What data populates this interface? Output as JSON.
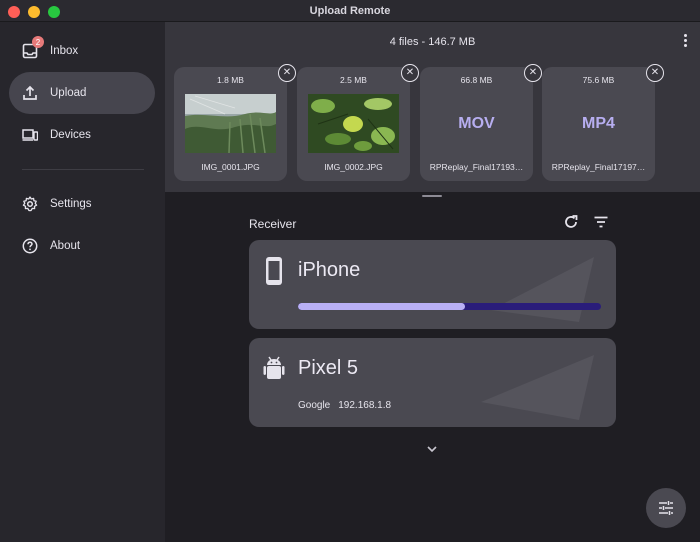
{
  "window": {
    "title": "Upload Remote"
  },
  "sidebar": {
    "items": [
      {
        "label": "Inbox",
        "icon": "inbox-icon",
        "badge": "2"
      },
      {
        "label": "Upload",
        "icon": "upload-icon",
        "active": true
      },
      {
        "label": "Devices",
        "icon": "devices-icon"
      },
      {
        "label": "Settings",
        "icon": "gear-icon"
      },
      {
        "label": "About",
        "icon": "help-circle-icon"
      }
    ]
  },
  "files": {
    "summary": "4 files - 146.7 MB",
    "items": [
      {
        "size": "1.8 MB",
        "name": "IMG_0001.JPG",
        "kind": "image"
      },
      {
        "size": "2.5 MB",
        "name": "IMG_0002.JPG",
        "kind": "image"
      },
      {
        "size": "66.8 MB",
        "name": "RPReplay_Final17193…",
        "ext": "MOV"
      },
      {
        "size": "75.6 MB",
        "name": "RPReplay_Final17197…",
        "ext": "MP4"
      }
    ]
  },
  "receiver": {
    "label": "Receiver",
    "devices": [
      {
        "name": "iPhone",
        "icon": "phone-icon",
        "progress": 0.55
      },
      {
        "name": "Pixel 5",
        "icon": "android-icon",
        "brand": "Google",
        "ip": "192.168.1.8"
      }
    ]
  },
  "colors": {
    "accent": "#b9b0f5",
    "progress_track": "#2a1d7a",
    "badge": "#e77a7a"
  }
}
